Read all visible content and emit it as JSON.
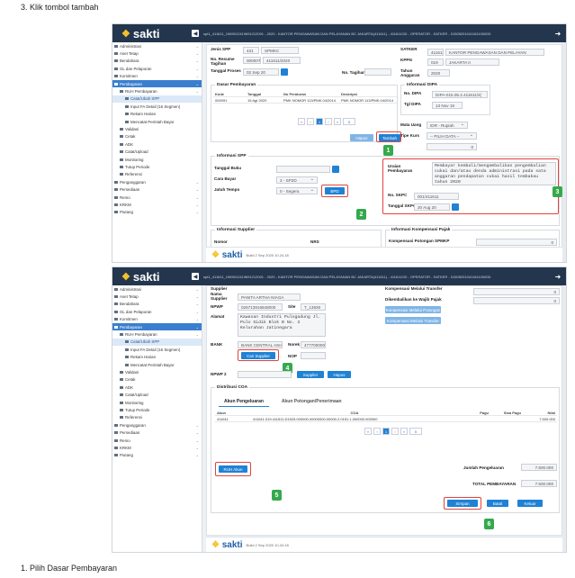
{
  "captions": {
    "top": "3.   Klik tombol tambah",
    "bottom": "1.   Pilih Dasar Pembayaran"
  },
  "app": {
    "brand": "sakti",
    "breadcrumb": "spt1_411611_1969012419691212001 - 2020 - KANTOR PENGAWASAN DAN PELAYANAN BC JAKARTA(411611) - 411611OD - OPERATOR - SATKER - 0150520104116110000D",
    "build": "Build 2 Sep 2020 10.24.18"
  },
  "sidebar": [
    "Administrasi",
    "Aset Tetap",
    "Bendahara",
    "GL dan Pelaporan",
    "Komitmen",
    "Pembayaran",
    "RUH Pembayaran",
    "Catat/Ubah SPP",
    "Input FA Detail (16 Segmen)",
    "Rekam Harian",
    "Mencatat Perintah Bayar",
    "Validasi",
    "Cetak",
    "ADK",
    "Catat/Upload",
    "Monitoring",
    "Tutup Periode",
    "Referensi",
    "Penganggaran",
    "Persediaan",
    "Remo",
    "KRKM",
    "Piutang"
  ],
  "s1": {
    "jenis_spp_label": "Jenis SPP",
    "jenis_spp_code": "431",
    "jenis_spp_name": "SPMKC",
    "resume_label": "No. Resume Tagihan",
    "resume_a": "00000T",
    "resume_b": "411611/2020",
    "tgl_proses_label": "Tanggal Proses",
    "tgl_proses": "02 Sep 20",
    "no_tagihan_label": "No. Tagihan",
    "satker_label": "SATKER",
    "satker_code": "411611",
    "satker_name": "KANTOR PENGAWASAN DAN PELAYAN",
    "kppn_label": "KPPN",
    "kppn_code": "019",
    "kppn_name": "JAKARTA II",
    "tahun_label": "Tahun Anggaran",
    "tahun": "2020",
    "dasar_title": "Dasar Pembayaran",
    "dasar_cols": [
      "Kode",
      "Tanggal",
      "No Peraturan",
      "Deskripsi"
    ],
    "dasar_row": [
      "000091",
      "15 Agt 2020",
      "PMK NOMOR 113/PMK.04/2014",
      "PMK NOMOR 113/PMK.04/2014"
    ],
    "page": "1",
    "per_page": "5",
    "btn_hapus": "Hapus",
    "btn_tambah": "Tambah",
    "dipa_title": "Informasi DIPA",
    "no_dipa_label": "No. DIPA",
    "no_dipa": "DIPA-015.05.2.411611/2(",
    "tgl_dipa_label": "Tgl DIPA",
    "tgl_dipa": "13 Nov 19",
    "mata_uang_label": "Mata Uang",
    "mata_uang": "IDR - Rupiah",
    "tipe_kurs_label": "Tipe Kurs",
    "tipe_kurs": "-- PILIH DATA --",
    "kurs": "0",
    "spp_title": "Informasi SPP",
    "tgl_buku_label": "Tanggal Buku",
    "cara_bayar_label": "Cara Bayar",
    "cara_bayar": "2 - SP2D",
    "jatuh_tempo_label": "Jatuh Tempo",
    "jatuh_tempo": "0 - Segera",
    "btn_bpd": "BPD",
    "uraian_label": "Uraian Pembayaran",
    "uraian": "Membayar kembali/mengembalikan pengembalian cukai dan/atau denda administrasi pada sata anggaran pendapatan cukai hasil tembakau tahun 2020",
    "no_skpc_label": "No. SKPC",
    "no_skpc": "001/411611",
    "tgl_skpc_label": "Tanggal SKPC",
    "tgl_skpc": "20 Aug 20",
    "supplier_title": "Informasi Supplier",
    "nomor_label": "Nomor",
    "nrs_label": "NRS",
    "pajak_title": "Informasi Kompensasi Pajak",
    "pot_spmkp_label": "Kompensasi Potongan SPMKP",
    "pot_spmkp": "0"
  },
  "s2": {
    "supplier_label": "Supplier",
    "nama_label": "Nama Supplier",
    "nama": "PANITA ARTHA NIAGA",
    "npwp_label": "NPWP",
    "npwp": "026713916848000",
    "site_label": "Site",
    "site": "T_13930",
    "alamat_label": "Alamat",
    "alamat": "Kawasan Industri Pulogadung Jl. Pulo Sidik Blok B No. 3 Kelurahan Jatinegara",
    "bank_label": "BANK",
    "bank": "BANK CENTRAL ASIA",
    "norek_label": "Norek",
    "norek": "4777000000",
    "nop_label": "NOP",
    "btn_cari": "Cari Supplier",
    "npwp2_label": "NPWP 2",
    "btn_supplier": "Supplier",
    "btn_hapus": "Hapus",
    "komp_transfer_label": "Kompensasi Melalui Transfer",
    "dikembalikan_label": "Dikembalikan ke Wajib Pajak",
    "btn_komp_pot": "Kompensasi Melalui Potongan",
    "btn_komp_tr": "Kompensasi Melalui Transfer",
    "zero1": "0",
    "zero2": "0",
    "coa_title": "Distribusi COA",
    "tab1": "Akun Pengeluaran",
    "tab2": "Akun Potongan/Penerimaan",
    "coa_cols": [
      "Akun",
      "COA",
      "Pagu",
      "Sisa Pagu",
      "Nilai"
    ],
    "coa_row": [
      "411611",
      "411611.019.411511.D1525.000000.00000000.00000.2.0151.1.000000.000000",
      "",
      "",
      "7.500.000"
    ],
    "page": "1",
    "per_page": "5",
    "btn_ruh": "RUH Akun",
    "jumlah_label": "Jumlah Pengeluaran",
    "jumlah": "7.500.000",
    "total_label": "TOTAL PEMBAYARAN",
    "total": "7.500.000",
    "btn_simpan": "Simpan",
    "btn_batal": "Batal",
    "btn_keluar": "Keluar"
  },
  "badges": [
    "1",
    "2",
    "3",
    "4",
    "5",
    "6"
  ]
}
